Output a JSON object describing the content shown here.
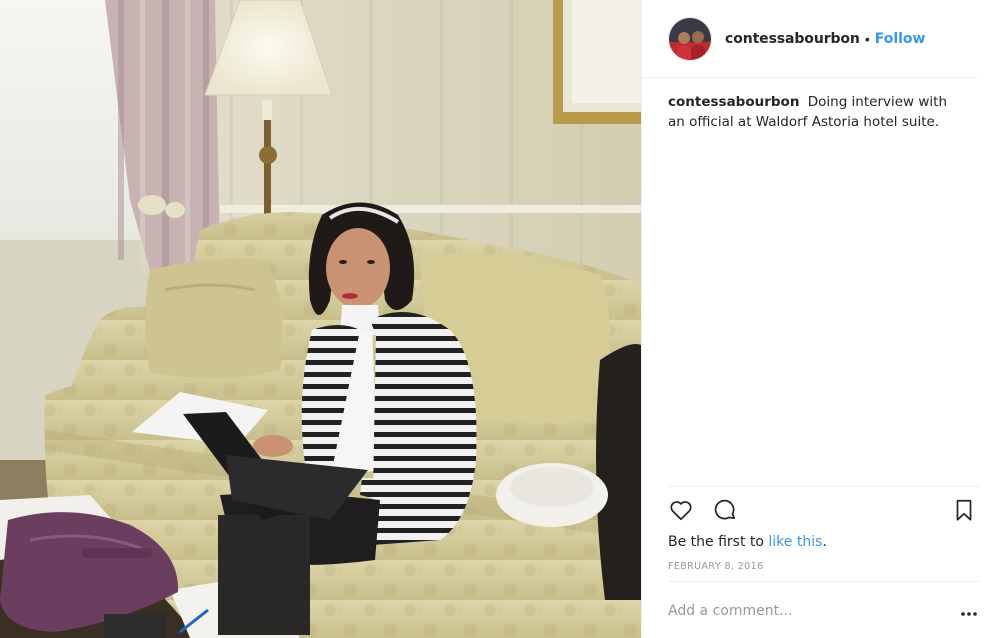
{
  "post": {
    "username": "contessabourbon",
    "separator": "•",
    "follow_label": "Follow",
    "caption_username": "contessabourbon",
    "caption_text": "Doing interview with an official at Waldorf Astoria hotel suite.",
    "likes_prefix": "Be the first to ",
    "likes_link": "like this",
    "likes_suffix": ".",
    "date": "February 8, 2016",
    "comment_placeholder": "Add a comment..."
  },
  "icons": {
    "like": "heart-outline-icon",
    "comment": "speech-bubble-icon",
    "save": "bookmark-outline-icon",
    "more": "ellipsis-icon"
  },
  "colors": {
    "link_blue": "#3897f0",
    "text": "#262626",
    "muted": "#999999",
    "divider": "#efefef"
  }
}
